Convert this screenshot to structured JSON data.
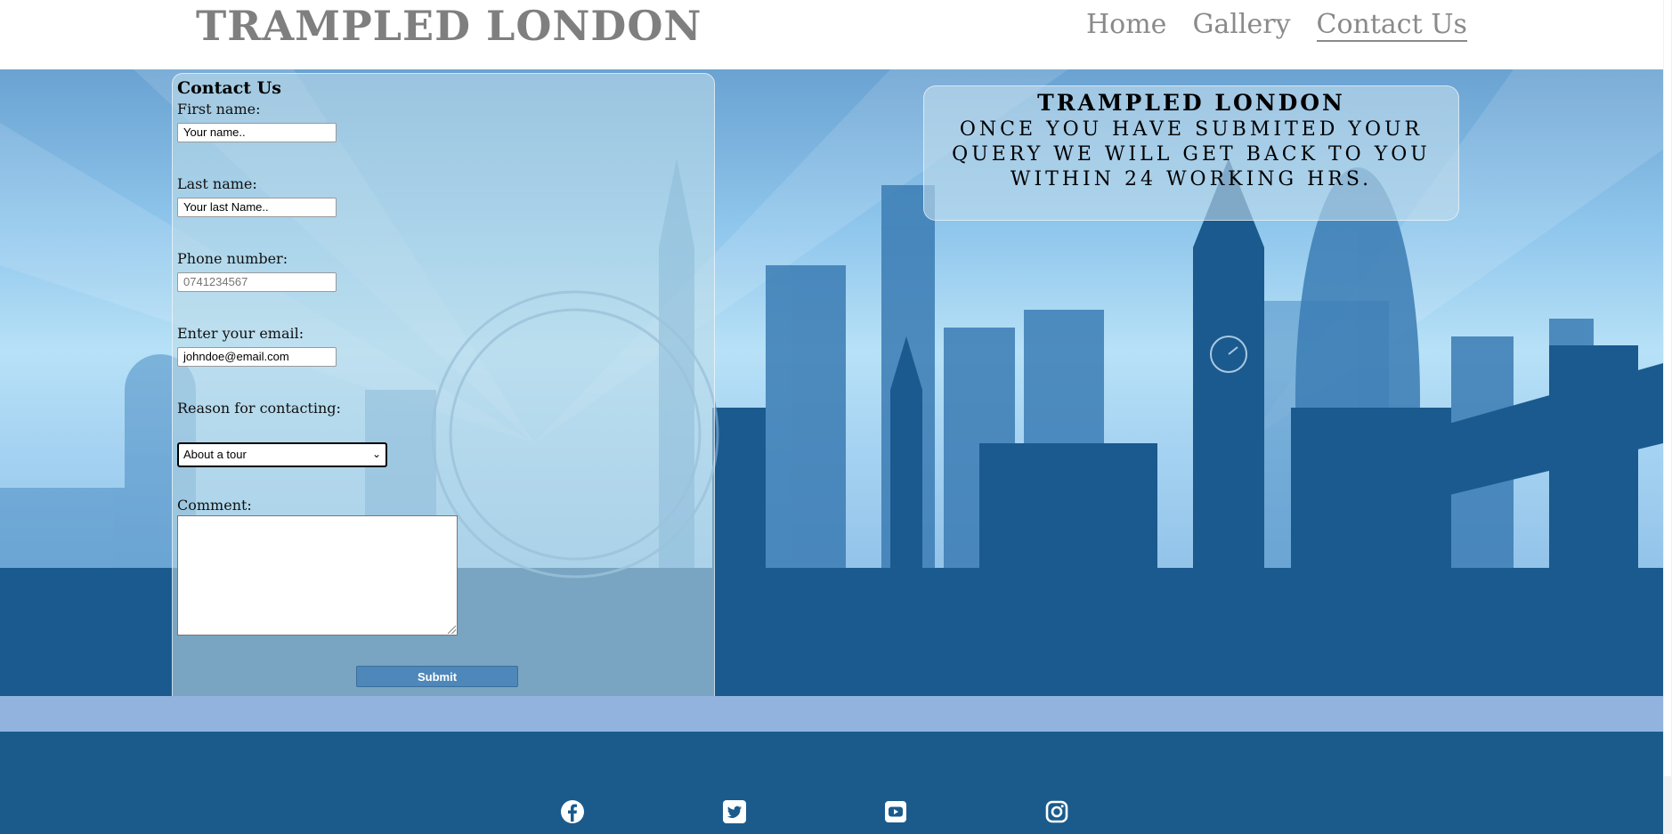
{
  "header": {
    "brand": "TRAMPLED LONDON",
    "nav": [
      "Home",
      "Gallery",
      "Contact Us"
    ],
    "active_nav": "Contact Us"
  },
  "form": {
    "title": "Contact Us",
    "first_name": {
      "label": "First name:",
      "value": "Your name.."
    },
    "last_name": {
      "label": "Last name:",
      "value": "Your last Name.."
    },
    "phone": {
      "label": "Phone number:",
      "placeholder": "0741234567"
    },
    "email": {
      "label": "Enter your email:",
      "value": "johndoe@email.com"
    },
    "reason": {
      "label": "Reason for contacting:",
      "selected": "About a tour"
    },
    "comment": {
      "label": "Comment:",
      "value": ""
    },
    "submit_label": "Submit"
  },
  "info": {
    "heading": "TRAMPLED LONDON",
    "message": "ONCE YOU HAVE SUBMITED YOUR QUERY WE WILL GET BACK TO YOU WITHIN 24 WORKING HRS."
  },
  "footer": {
    "social_icons": [
      "facebook-icon",
      "twitter-icon",
      "youtube-icon",
      "instagram-icon"
    ]
  },
  "colors": {
    "footer_bg": "#1a5b8c",
    "strip_bg": "#93b3df",
    "skyline_dark": "#1b5a8e",
    "submit_bg": "#4e87b9"
  }
}
